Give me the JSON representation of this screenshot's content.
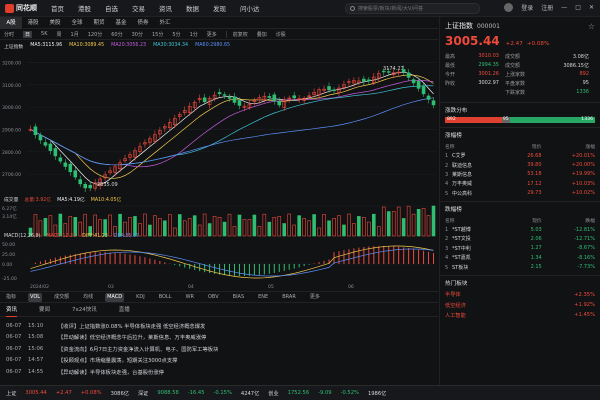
{
  "app": {
    "logo": "同花顺"
  },
  "topnav": [
    "首页",
    "港股",
    "自选",
    "交易",
    "资讯",
    "数据",
    "发现",
    "问小达"
  ],
  "search": {
    "placeholder": "搜索股票/板块/新闻/大V/问答"
  },
  "topright": {
    "login": "登录",
    "register": "注册"
  },
  "market_tabs": [
    "A股",
    "港股",
    "美股",
    "全球",
    "期货",
    "基金",
    "债券",
    "外汇"
  ],
  "period_tabs": [
    "分时",
    "日",
    "5K",
    "周",
    "1月",
    "120分",
    "60分",
    "30分",
    "15分",
    "5分",
    "1分",
    "更多",
    "前复权",
    "叠加",
    "诊股"
  ],
  "ma_legend": {
    "title": "上证指数",
    "ma5": "MA5:3115.96",
    "ma10": "MA10:3089.45",
    "ma20": "MA20:3056.23",
    "ma30": "MA30:3034.34",
    "ma60": "MA60:2980.65"
  },
  "colors": {
    "up": "#ee4a3c",
    "down": "#2fbf73",
    "ma5": "#f0f0f0",
    "ma10": "#f2c94c",
    "ma20": "#c45be0",
    "ma30": "#3ec2d6",
    "ma60": "#5b8ff9"
  },
  "y_labels": [
    "3200.00",
    "3100.00",
    "3000.00",
    "2900.00",
    "2800.00",
    "2700.00"
  ],
  "annotations": {
    "high": "3174.27",
    "low": "2635.09"
  },
  "vol_legend": {
    "title": "成交量",
    "val": "总量:3.92亿",
    "ma5": "MA5:4.19亿",
    "ma10": "MA10:4.05亿"
  },
  "vol_y": [
    "6.27亿",
    "3.14亿"
  ],
  "macd_legend": {
    "title": "MACD(12,26,9)",
    "macd": "MACD:12.31",
    "dif": "DIFF:41.23",
    "dea": "DEA:35.07"
  },
  "macd_y": [
    "50.00",
    "25.00",
    "0.00",
    "-25.00"
  ],
  "x_labels": [
    "2024/02",
    "03",
    "04",
    "05",
    "06"
  ],
  "indicator_tabs": [
    "指标",
    "VOL",
    "成交额",
    "均线",
    "MACD",
    "KDJ",
    "BOLL",
    "WR",
    "OBV",
    "BIAS",
    "ENE",
    "BRAR",
    "更多"
  ],
  "news_tabs": [
    "资讯",
    "要闻",
    "7x24快讯",
    "直播"
  ],
  "news": [
    {
      "date": "06-07",
      "time": "15:10",
      "text": "【收评】上证指数涨0.08% 半导体板块走强 低空经济概念爆发"
    },
    {
      "date": "06-07",
      "time": "15:08",
      "text": "【异动解读】低空经济概念午后拉升，莱斯信息、万丰奥威涨停"
    },
    {
      "date": "06-07",
      "time": "15:06",
      "text": "【资金流向】6月7日主力资金净流入计算机、电子、国防军工等板块"
    },
    {
      "date": "06-07",
      "time": "14:57",
      "text": "【投顾观点】市场缩量震荡，短期关注3000点支撑"
    },
    {
      "date": "06-07",
      "time": "14:55",
      "text": "【异动解读】半导体板块走强，台基股份涨停"
    }
  ],
  "quote": {
    "name": "上证指数",
    "code": "000001",
    "price": "3005.44",
    "change": "+2.47",
    "pct": "+0.08%",
    "stats": [
      {
        "k1": "最高",
        "v1": "3010.03",
        "k2": "成交额",
        "v2": "3.08亿"
      },
      {
        "k1": "最低",
        "v1": "2994.35",
        "k2": "成交额",
        "v2": "3086.15亿"
      },
      {
        "k1": "今开",
        "v1": "3001.26",
        "k2": "上涨家数",
        "v2": "892"
      },
      {
        "k1": "昨收",
        "v1": "3002.97",
        "k2": "平盘家数",
        "v2": "95"
      },
      {
        "k1": "",
        "v1": "",
        "k2": "下跌家数",
        "v2": "1336"
      }
    ]
  },
  "distribution": {
    "title": "涨跌分布",
    "up": "892",
    "flat": "95",
    "down": "1336"
  },
  "gainers": {
    "title": "涨幅榜",
    "headers": [
      "名称",
      "现价",
      "涨幅"
    ],
    "rows": [
      {
        "n": "1",
        "name": "C艾罗",
        "price": "26.68",
        "pct": "+20.01%"
      },
      {
        "n": "2",
        "name": "联迪信息",
        "price": "39.80",
        "pct": "+20.00%"
      },
      {
        "n": "3",
        "name": "莱斯信息",
        "price": "53.18",
        "pct": "+19.99%"
      },
      {
        "n": "4",
        "name": "万丰奥威",
        "price": "17.12",
        "pct": "+10.03%"
      },
      {
        "n": "5",
        "name": "中公高科",
        "price": "29.73",
        "pct": "+10.02%"
      }
    ]
  },
  "losers": {
    "title": "跌幅榜",
    "headers": [
      "名称",
      "现价",
      "跌幅"
    ],
    "rows": [
      {
        "n": "1",
        "name": "*ST越博",
        "price": "5.03",
        "pct": "-12.81%"
      },
      {
        "n": "2",
        "name": "*ST文投",
        "price": "2.06",
        "pct": "-12.71%"
      },
      {
        "n": "3",
        "name": "*ST中利",
        "price": "1.27",
        "pct": "-8.67%"
      },
      {
        "n": "4",
        "name": "*ST嘉凯",
        "price": "1.34",
        "pct": "-8.16%"
      },
      {
        "n": "5",
        "name": "ST板块",
        "price": "2.15",
        "pct": "-7.73%"
      }
    ]
  },
  "hot_sectors": {
    "title": "热门板块",
    "rows": [
      {
        "name": "半导体",
        "pct": "+2.35%"
      },
      {
        "name": "低空经济",
        "pct": "+1.92%"
      },
      {
        "name": "人工智能",
        "pct": "+1.45%"
      }
    ]
  },
  "status": {
    "idx1_name": "上证",
    "idx1_val": "3005.44",
    "idx1_chg": "+2.47",
    "idx1_pct": "+0.08%",
    "idx1_amt": "3086亿",
    "idx2_name": "深证",
    "idx2_val": "9088.58",
    "idx2_chg": "-16.45",
    "idx2_pct": "-0.15%",
    "idx2_amt": "4247亿",
    "idx3_name": "创业",
    "idx3_val": "1752.56",
    "idx3_chg": "-9.09",
    "idx3_pct": "-0.52%",
    "idx3_amt": "1986亿"
  }
}
